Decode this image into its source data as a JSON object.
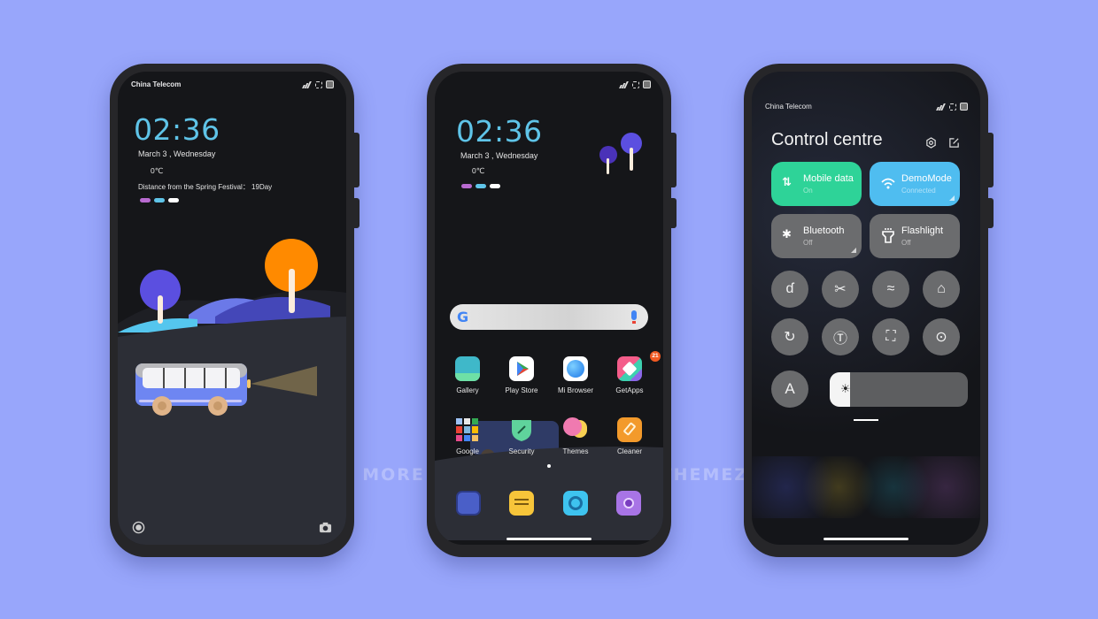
{
  "background_color": "#98a6fb",
  "watermark": "R MORE THEMES VISIT - MIUITHEMEZ.COM",
  "status_icons": [
    "signal-icon",
    "screen-record-icon",
    "battery-icon"
  ],
  "lock_screen": {
    "carrier": "China Telecom",
    "time": "02:36",
    "date": "March  3 , Wednesday",
    "temperature": "0℃",
    "countdown": "Distance from the Spring Festival： 19Day",
    "indicator_colors": [
      "#b86ad0",
      "#5fc4e8",
      "#ffffff"
    ],
    "bottom_left_icon": "assistant-icon",
    "bottom_right_icon": "camera-icon"
  },
  "home_screen": {
    "time": "02:36",
    "date": "March  3 , Wednesday",
    "temperature": "0℃",
    "indicator_colors": [
      "#b86ad0",
      "#5fc4e8",
      "#ffffff"
    ],
    "search_icon": "google-icon",
    "voice_icon": "mic-icon",
    "apps": [
      {
        "label": "Gallery",
        "icon": "gallery-icon",
        "color": "#3fb8c9"
      },
      {
        "label": "Play Store",
        "icon": "play-store-icon",
        "color": "#ffffff"
      },
      {
        "label": "Mi Browser",
        "icon": "browser-icon",
        "color": "#ffffff"
      },
      {
        "label": "GetApps",
        "icon": "getapps-icon",
        "color": "#f45d8a",
        "badge": "21"
      },
      {
        "label": "Google",
        "icon": "google-folder-icon",
        "color": "transparent"
      },
      {
        "label": "Security",
        "icon": "shield-icon",
        "color": "#5fd39c"
      },
      {
        "label": "Themes",
        "icon": "themes-icon",
        "color": "#f07ab0"
      },
      {
        "label": "Cleaner",
        "icon": "cleaner-icon",
        "color": "#f39a2b"
      }
    ],
    "dock": [
      {
        "icon": "phone-icon",
        "color": "#4a5fc8"
      },
      {
        "icon": "messages-icon",
        "color": "#f7c53a"
      },
      {
        "icon": "chrome-icon",
        "color": "#3ec3ef"
      },
      {
        "icon": "camera-icon",
        "color": "#a874e6"
      }
    ]
  },
  "control_centre": {
    "carrier": "China Telecom",
    "title": "Control centre",
    "header_icons": [
      "settings-icon",
      "edit-icon"
    ],
    "tiles": [
      {
        "title": "Mobile data",
        "status": "On",
        "icon": "mobile-data-icon",
        "color": "#2ed398"
      },
      {
        "title": "DemoMode",
        "status": "Connected",
        "icon": "wifi-icon",
        "color": "#4fbdf0"
      },
      {
        "title": "Bluetooth",
        "status": "Off",
        "icon": "bluetooth-icon",
        "color": "#6b6c6e"
      },
      {
        "title": "Flashlight",
        "status": "Off",
        "icon": "flashlight-icon",
        "color": "#6b6c6e"
      }
    ],
    "toggles": [
      {
        "icon": "dnd-icon",
        "glyph": "ɗ"
      },
      {
        "icon": "scissors-icon",
        "glyph": "✂"
      },
      {
        "icon": "airplane-icon",
        "glyph": "≈"
      },
      {
        "icon": "lock-rotation-icon",
        "glyph": "⌂"
      },
      {
        "icon": "hotspot-icon",
        "glyph": "↻"
      },
      {
        "icon": "auto-text-icon",
        "glyph": "Ⓣ"
      },
      {
        "icon": "screenshot-icon",
        "glyph": "⛶"
      },
      {
        "icon": "eye-icon",
        "glyph": "⊙"
      }
    ],
    "auto_brightness_label": "A",
    "brightness_percent": 15
  }
}
